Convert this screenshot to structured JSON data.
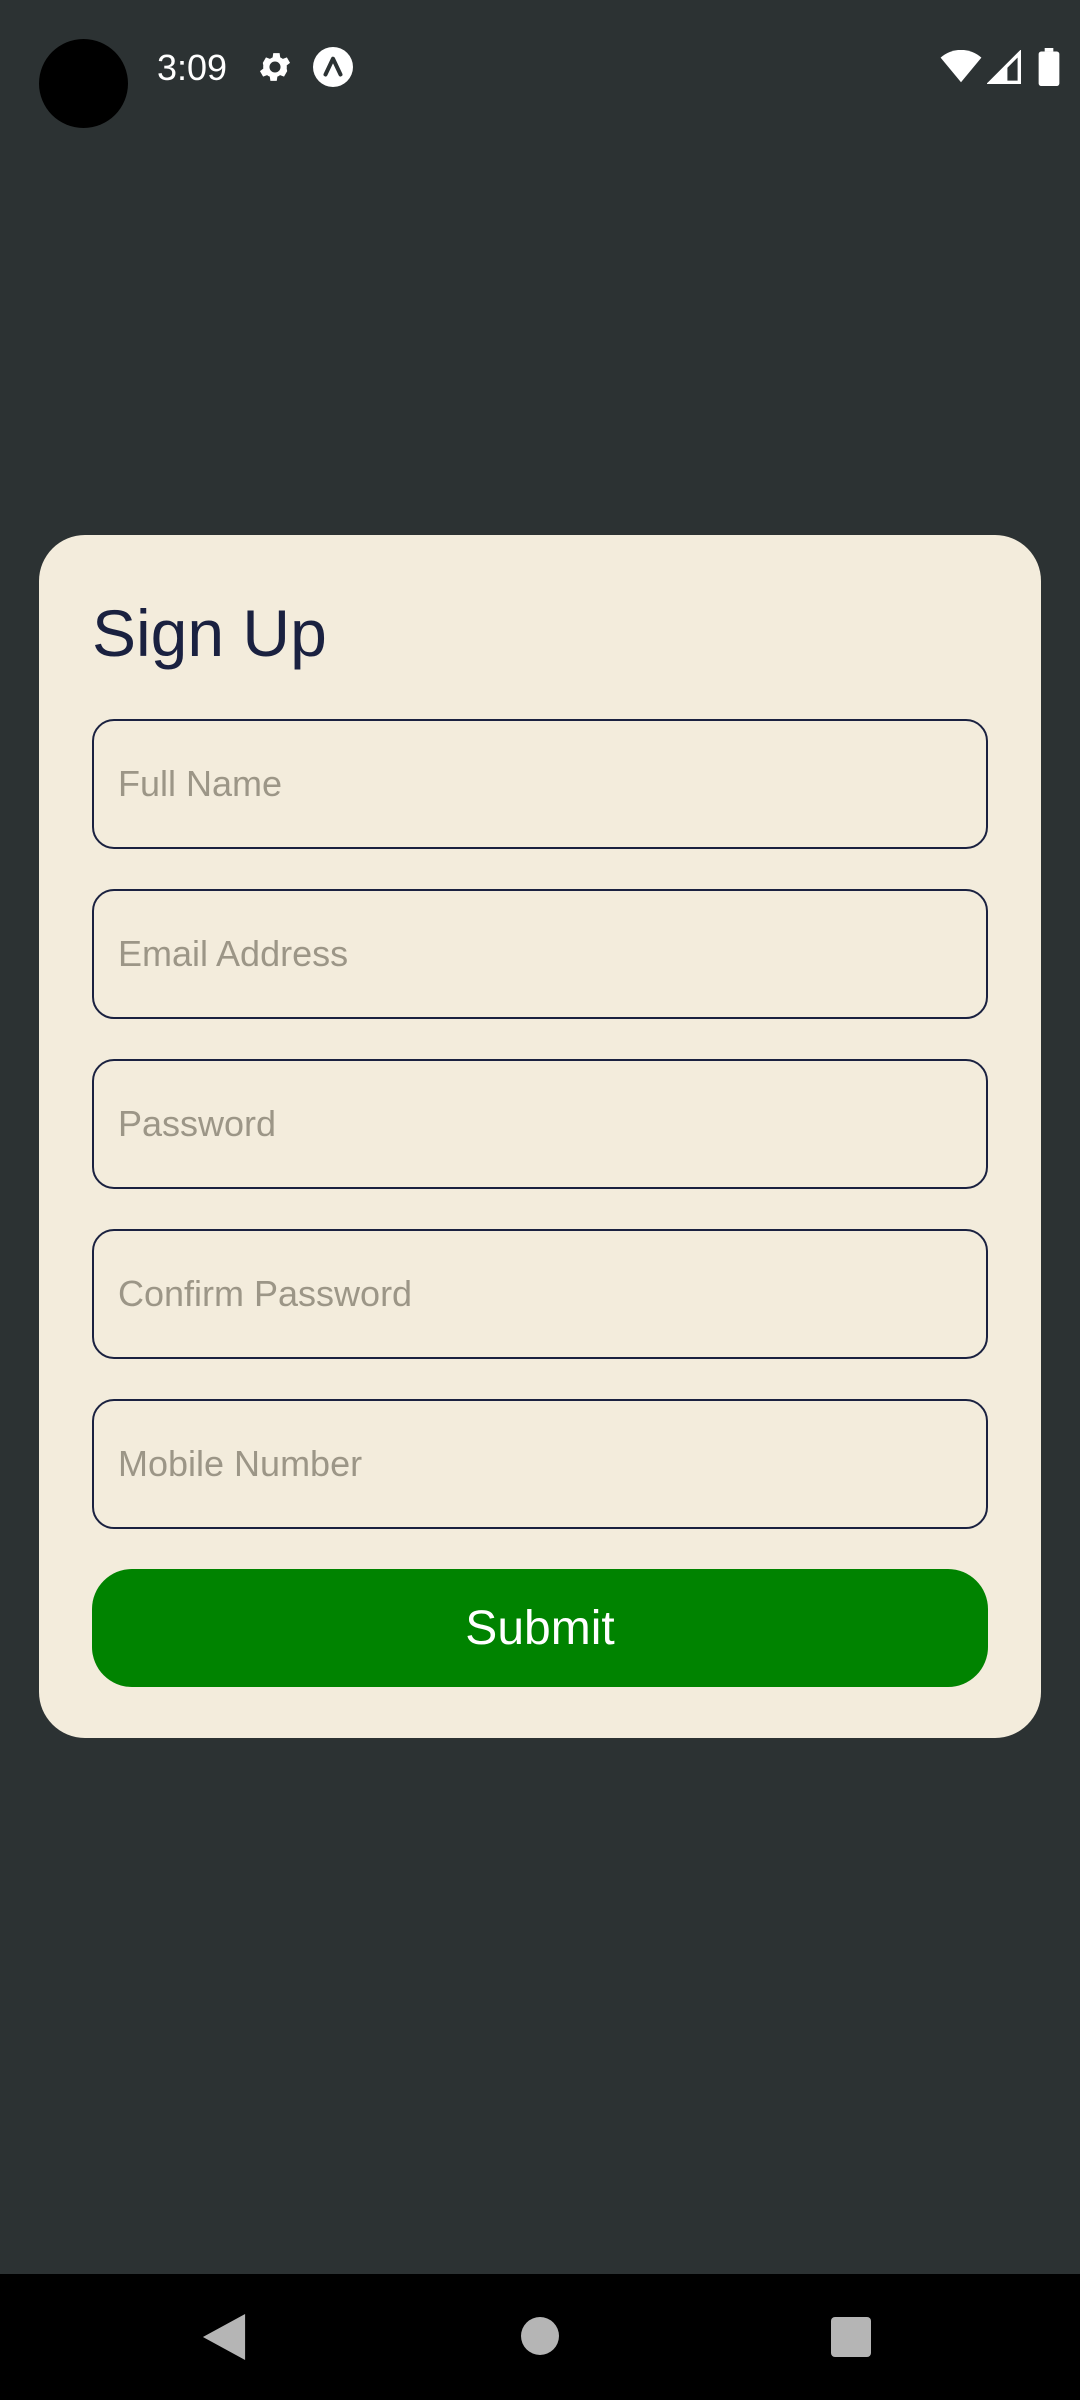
{
  "status_bar": {
    "time": "3:09",
    "icons": [
      "gear-icon",
      "app-icon",
      "wifi-icon",
      "signal-icon",
      "battery-icon"
    ]
  },
  "form": {
    "title": "Sign Up",
    "fields": [
      {
        "name": "full-name",
        "placeholder": "Full Name",
        "value": ""
      },
      {
        "name": "email",
        "placeholder": "Email Address",
        "value": ""
      },
      {
        "name": "password",
        "placeholder": "Password",
        "value": ""
      },
      {
        "name": "confirm-password",
        "placeholder": "Confirm Password",
        "value": ""
      },
      {
        "name": "mobile-number",
        "placeholder": "Mobile Number",
        "value": ""
      }
    ],
    "submit_label": "Submit"
  },
  "nav_bar": {
    "icons": [
      "back-icon",
      "home-icon",
      "recents-icon"
    ]
  },
  "colors": {
    "background": "#2c3233",
    "card": "#f3ecdc",
    "text": "#1a2140",
    "placeholder": "#9c9687",
    "submit": "#008300"
  }
}
